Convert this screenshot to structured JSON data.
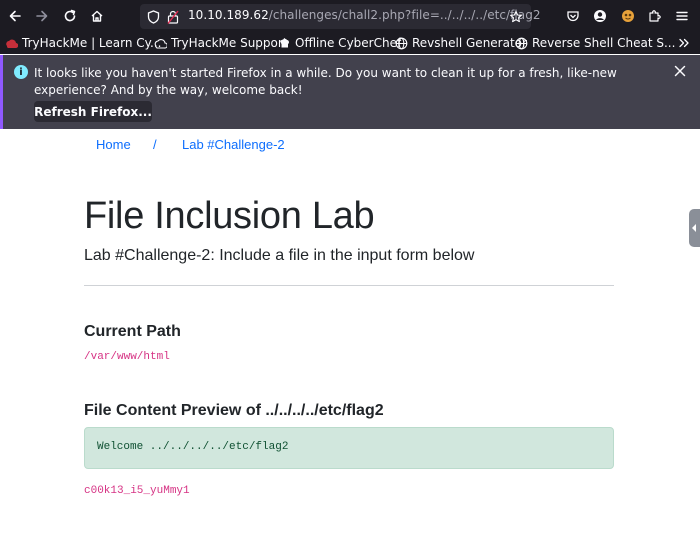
{
  "browser": {
    "url_host": "10.10.189.62",
    "url_path": "/challenges/chall2.php?file=../../../../etc/flag2",
    "icons": [
      "back-icon",
      "forward-icon",
      "reload-icon",
      "home-icon",
      "shield-icon",
      "lock-icon",
      "star-icon",
      "pocket-icon",
      "account-icon",
      "extension-icon",
      "extensions-puzzle-icon",
      "menu-icon"
    ]
  },
  "bookmarks": [
    {
      "label": "TryHackMe | Learn Cy...",
      "icon": "tryhackme-icon"
    },
    {
      "label": "TryHackMe Support",
      "icon": "support-icon"
    },
    {
      "label": "Offline CyberChef",
      "icon": "chef-icon"
    },
    {
      "label": "Revshell Generator",
      "icon": "globe-icon"
    },
    {
      "label": "Reverse Shell Cheat S...",
      "icon": "globe-icon"
    }
  ],
  "notification": {
    "message": "It looks like you haven't started Firefox in a while. Do you want to clean it up for a fresh, like-new experience? And by the way, welcome back!",
    "button_label": "Refresh Firefox..."
  },
  "page": {
    "breadcrumb": {
      "home": "Home",
      "separator": "/",
      "current": "Lab #Challenge-2"
    },
    "title": "File Inclusion Lab",
    "subtitle": "Lab #Challenge-2: Include a file in the input form below",
    "current_path_heading": "Current Path",
    "current_path_value": "/var/www/html",
    "preview_heading": "File Content Preview of ../../../../etc/flag2",
    "preview_content": "Welcome ../../../../etc/flag2",
    "flag": "c00k13_i5_yuMmy1"
  },
  "colors": {
    "link": "#0d6efd",
    "code": "#d63384",
    "alert_bg": "#d1e7dd",
    "alert_text": "#0f5132",
    "chrome_bg": "#1c1b22",
    "notification_bg": "#42414d"
  }
}
